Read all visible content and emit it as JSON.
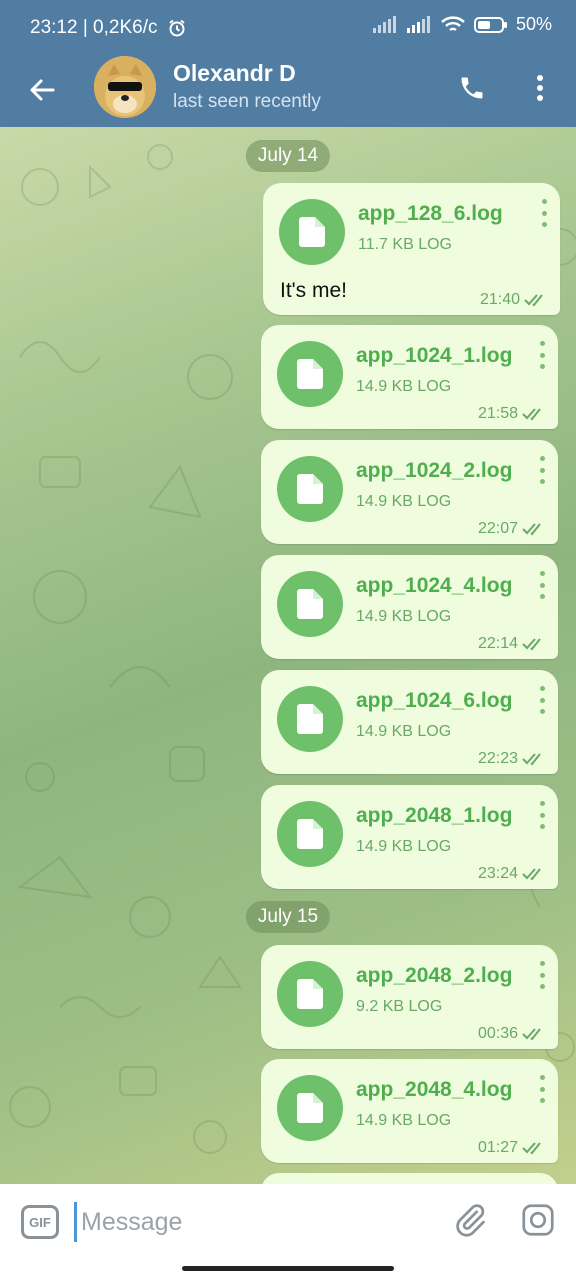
{
  "status_bar": {
    "time": "23:12 | 0,2K6/c",
    "battery": "50%"
  },
  "header": {
    "contact_name": "Olexandr D",
    "contact_status": "last seen recently",
    "back_icon": "arrow-left-icon",
    "call_icon": "phone-icon",
    "menu_icon": "more-vertical-icon"
  },
  "chat": {
    "dates": [
      "July 14",
      "July 15"
    ],
    "messages": [
      {
        "name": "app_128_6.log",
        "size": "11.7 KB LOG",
        "time": "21:40",
        "caption": "It's me!"
      },
      {
        "name": "app_1024_1.log",
        "size": "14.9 KB LOG",
        "time": "21:58"
      },
      {
        "name": "app_1024_2.log",
        "size": "14.9 KB LOG",
        "time": "22:07"
      },
      {
        "name": "app_1024_4.log",
        "size": "14.9 KB LOG",
        "time": "22:14"
      },
      {
        "name": "app_1024_6.log",
        "size": "14.9 KB LOG",
        "time": "22:23"
      },
      {
        "name": "app_2048_1.log",
        "size": "14.9 KB LOG",
        "time": "23:24"
      },
      {
        "name": "app_2048_2.log",
        "size": "9.2 KB LOG",
        "time": "00:36"
      },
      {
        "name": "app_2048_4.log",
        "size": "14.9 KB LOG",
        "time": "01:27"
      }
    ]
  },
  "composer": {
    "gif_label": "GIF",
    "placeholder": "Message"
  },
  "colors": {
    "header": "#517da2",
    "bubble": "#effdde",
    "file_accent": "#6ec16a",
    "file_text": "#4fae4e"
  }
}
